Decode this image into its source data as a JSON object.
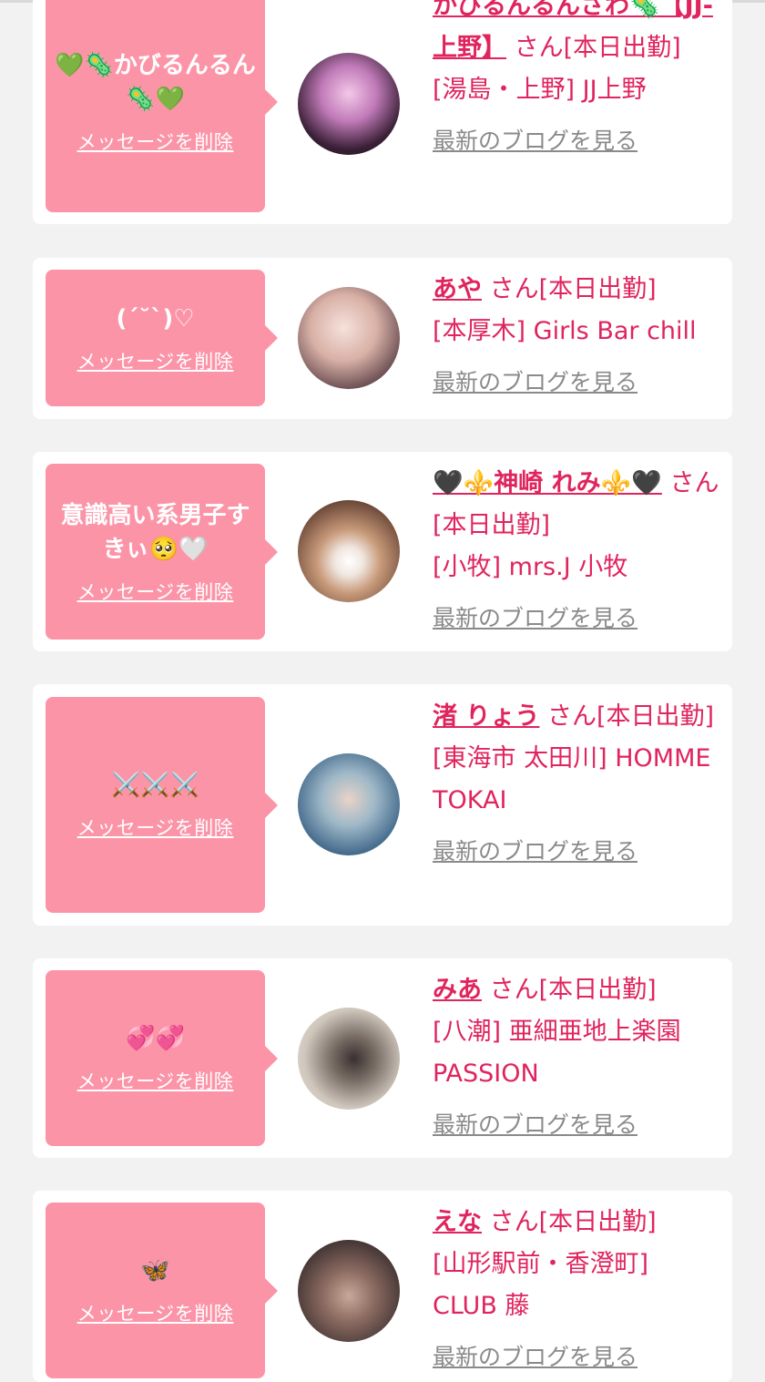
{
  "delete_label": "メッセージを削除",
  "blog_label": "最新のブログを見る",
  "colors": {
    "bubble": "#fc94a8",
    "accent": "#e0245e",
    "link_gray": "#8a8a8a",
    "page_bg": "#f2f2f2"
  },
  "cards": [
    {
      "message": "💚🦠かびるんるん🦠💚",
      "name": "かびるんるんさわ🦠【JJ-上野】",
      "suffix": "さん[本日出勤]",
      "shop": "[湯島・上野] JJ上野"
    },
    {
      "message": "(ˊ˘ˋ)♡",
      "name": "あや",
      "suffix": "さん[本日出勤]",
      "shop": "[本厚木] Girls Bar chill"
    },
    {
      "message": "意識高い系男子すきぃ🥺🤍",
      "name": "🖤⚜️神崎 れみ⚜️🖤",
      "suffix": "さん[本日出勤]",
      "shop": "[小牧] mrs.J 小牧"
    },
    {
      "message": "⚔️⚔️⚔️",
      "name": "渚 りょう",
      "suffix": "さん[本日出勤]",
      "shop": "[東海市 太田川] HOMME TOKAI"
    },
    {
      "message": "💞💞",
      "name": "みあ",
      "suffix": "さん[本日出勤]",
      "shop": "[八潮] 亜細亜地上楽園 PASSION"
    },
    {
      "message": "🦋",
      "name": "えな",
      "suffix": "さん[本日出勤]",
      "shop": "[山形駅前・香澄町] CLUB 藤"
    }
  ]
}
